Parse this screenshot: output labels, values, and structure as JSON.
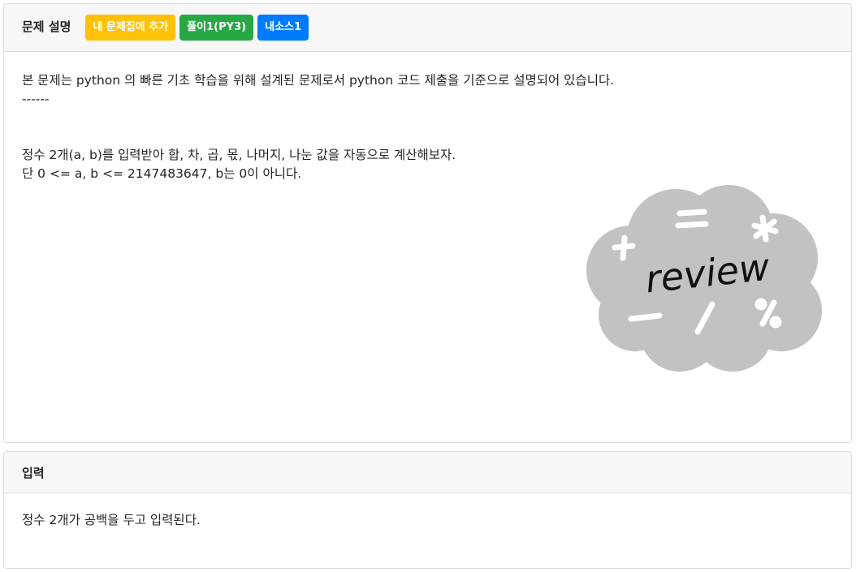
{
  "description": {
    "title": "문제 설명",
    "buttons": [
      {
        "label": "내 문제집에 추가",
        "color": "#ffc107"
      },
      {
        "label": "풀이1(PY3)",
        "color": "#28a745"
      },
      {
        "label": "내소스1",
        "color": "#007bff"
      }
    ],
    "lines": [
      "본 문제는 python 의 빠른 기초 학습을 위해 설계된 문제로서 python 코드 제출을 기준으로 설명되어 있습니다.",
      "------",
      "정수 2개(a, b)를 입력받아 합, 차, 곱, 몫, 나머지, 나눈 값을 자동으로 계산해보자.",
      "단 0 <= a, b <= 2147483647, b는 0이 아니다."
    ],
    "image": {
      "icon": "review-cloud-icon",
      "text": "review",
      "symbols": [
        "+",
        "=",
        "*",
        "−",
        "/",
        "%"
      ],
      "cloud_color": "#c2c2c2"
    }
  },
  "input": {
    "title": "입력",
    "text": "정수 2개가 공백을 두고 입력된다."
  }
}
